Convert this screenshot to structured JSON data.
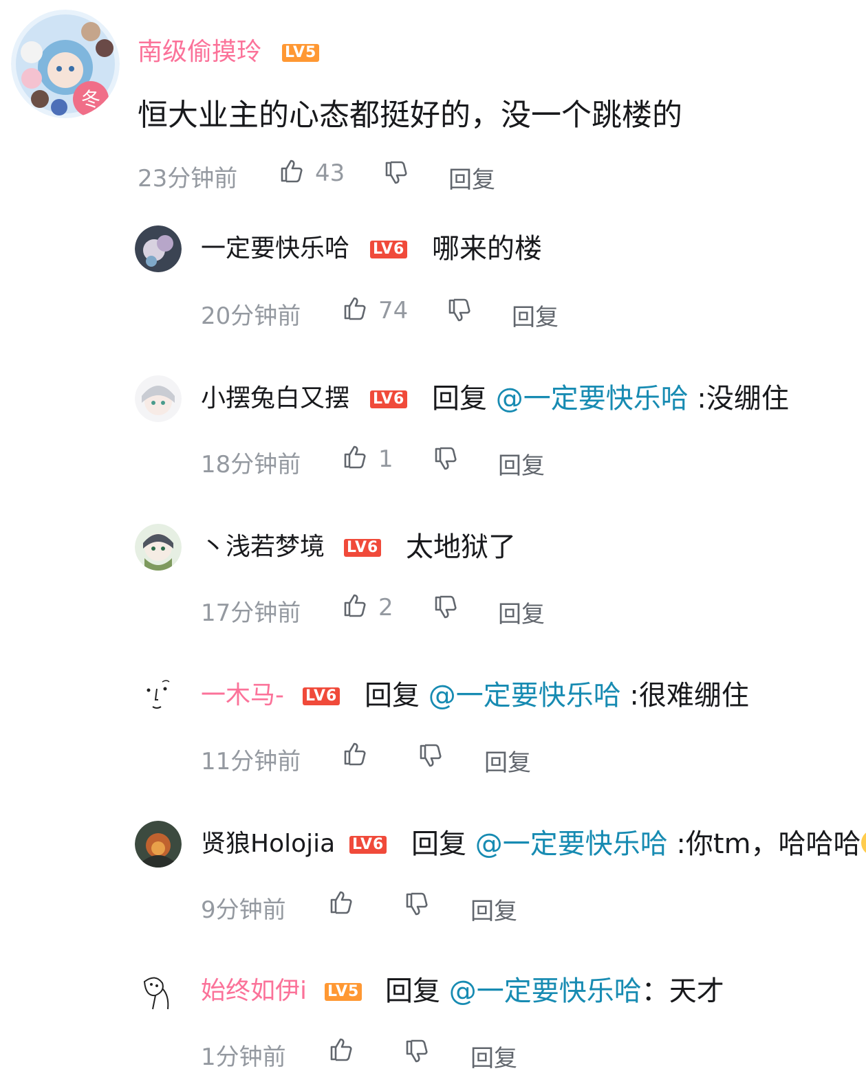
{
  "main_comment": {
    "username": "南级偷摸玲",
    "level": "LV5",
    "text": "恒大业主的心态都挺好的，没一个跳楼的",
    "time": "23分钟前",
    "likes": "43",
    "reply_label": "回复",
    "avatar_badge": "冬"
  },
  "replies": [
    {
      "username": "一定要快乐哈",
      "level": "LV6",
      "text": "哪来的楼",
      "time": "20分钟前",
      "likes": "74",
      "reply_label": "回复"
    },
    {
      "username": "小摆兔白又摆",
      "level": "LV6",
      "reply_prefix": "回复",
      "mention": "@一定要快乐哈",
      "text": " :没绷住",
      "time": "18分钟前",
      "likes": "1",
      "reply_label": "回复"
    },
    {
      "username": "丶浅若梦境",
      "level": "LV6",
      "text": "太地狱了",
      "time": "17分钟前",
      "likes": "2",
      "reply_label": "回复"
    },
    {
      "username": "一木马-",
      "level": "LV6",
      "reply_prefix": "回复",
      "mention": "@一定要快乐哈",
      "text": " :很难绷住",
      "time": "11分钟前",
      "likes": "",
      "reply_label": "回复"
    },
    {
      "username": "贤狼Holojia",
      "level": "LV6",
      "reply_prefix": "回复",
      "mention": "@一定要快乐哈",
      "text": " :你tm，哈哈哈",
      "time": "9分钟前",
      "likes": "",
      "reply_label": "回复"
    },
    {
      "username": "始终如伊i",
      "level": "LV5",
      "reply_prefix": "回复",
      "mention": "@一定要快乐哈",
      "text": "：天才",
      "time": "1分钟前",
      "likes": "",
      "reply_label": "回复"
    }
  ],
  "colors": {
    "vip_name": "#fb7299",
    "normal_name": "#18191c",
    "mention": "#178bb2",
    "meta": "#9499a0",
    "lv5": "#ff9833",
    "lv6": "#f04a3a"
  }
}
